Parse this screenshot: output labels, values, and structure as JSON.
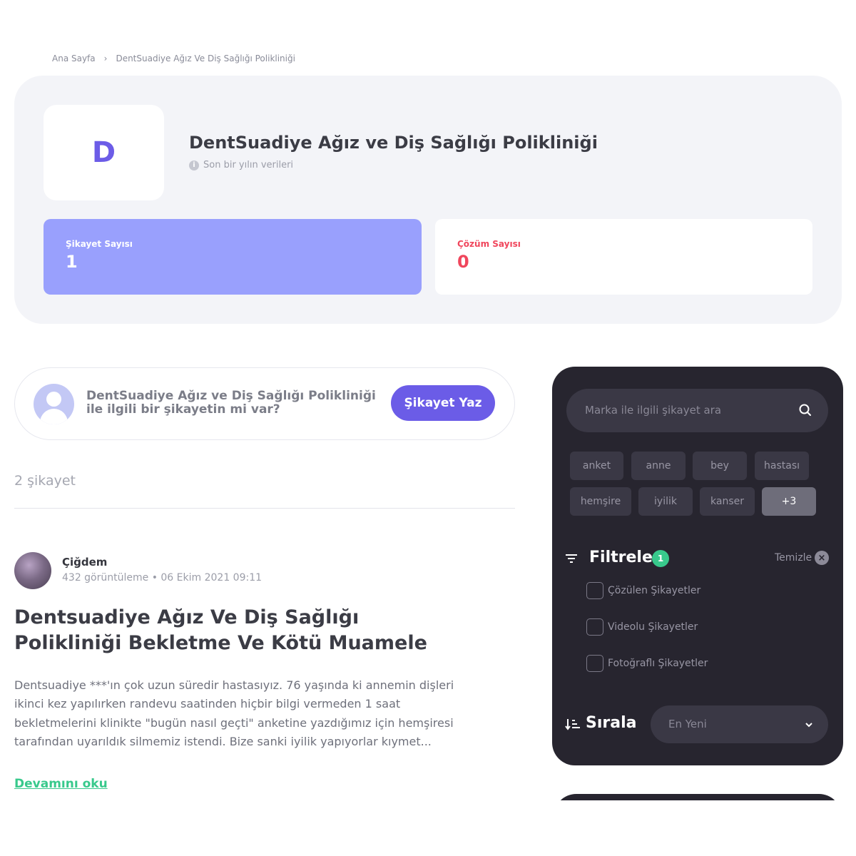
{
  "breadcrumb": {
    "home": "Ana Sayfa",
    "current": "DentSuadiye Ağız Ve Diş Sağlığı Polikliniği"
  },
  "brand": {
    "initial": "D",
    "name": "DentSuadiye Ağız ve Diş Sağlığı Polikliniği",
    "subtitle": "Son bir yılın verileri"
  },
  "stats": {
    "complaints_label": "Şikayet Sayısı",
    "complaints_value": "1",
    "solutions_label": "Çözüm Sayısı",
    "solutions_value": "0"
  },
  "write": {
    "prompt": "DentSuadiye Ağız ve Diş Sağlığı Polikliniği ile ilgili bir şikayetin mi var?",
    "button": "Şikayet Yaz"
  },
  "list": {
    "count": "2 şikayet"
  },
  "post": {
    "author": "Çiğdem",
    "meta": "432 görüntüleme • 06 Ekim 2021 09:11",
    "title": "Dentsuadiye Ağız Ve Diş Sağlığı Polikliniği Bekletme Ve Kötü Muamele",
    "body": "Dentsuadiye ***'ın çok uzun süredir hastasıyız. 76 yaşında ki annemin dişleri ikinci kez yapılırken randevu saatinden hiçbir bilgi vermeden 1 saat bekletmelerini klinikte \"bugün nasıl geçti\" anketine yazdığımız için hemşiresi tarafından uyarıldık silmemiz istendi. Bize sanki iyilik yapıyorlar kıymet...",
    "read_more": "Devamını oku"
  },
  "sidebar": {
    "search_placeholder": "Marka ile ilgili şikayet ara",
    "tags": [
      "anket",
      "anne",
      "bey",
      "hastası",
      "hemşire",
      "iyilik",
      "kanser",
      "+3"
    ],
    "filter_title": "Filtrele",
    "filter_count": "1",
    "clear_label": "Temizle",
    "filters": [
      "Çözülen Şikayetler",
      "Videolu Şikayetler",
      "Fotoğraflı Şikayetler"
    ],
    "sort_title": "Sırala",
    "sort_value": "En Yeni"
  },
  "colors": {
    "accent": "#6b5ce7",
    "complaint_card": "#99a0fd",
    "solution_text": "#f0465c",
    "sidebar_bg": "#27252f",
    "success": "#38c98c"
  }
}
